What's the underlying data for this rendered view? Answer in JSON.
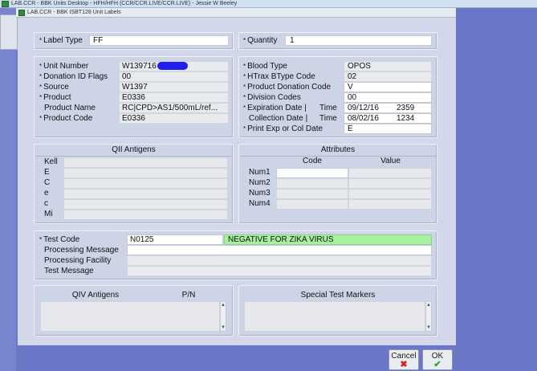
{
  "app": {
    "title": "LAB.CCR - BBK Units Desktop - HFH/HFH (CCR/CCR.LIVE/CCR.LIVE) - Jessie W Beeley"
  },
  "dialog": {
    "title": "LAB.CCR - BBK ISBT128 Unit Labels"
  },
  "top": {
    "label_type_label": "Label Type",
    "label_type_value": "FF",
    "quantity_label": "Quantity",
    "quantity_value": "1"
  },
  "unit": {
    "unit_number_label": "Unit Number",
    "unit_number_value": "W139716",
    "donation_flags_label": "Donation ID Flags",
    "donation_flags_value": "00",
    "source_label": "Source",
    "source_value": "W1397",
    "product_label": "Product",
    "product_value": "E0336",
    "product_name_label": "Product Name",
    "product_name_value": "RC|CPD>AS1/500mL/ref...",
    "product_code_label": "Product Code",
    "product_code_value": "E0336"
  },
  "blood": {
    "blood_type_label": "Blood Type",
    "blood_type_value": "OPOS",
    "htrax_label": "HTrax BType Code",
    "htrax_value": "02",
    "pdc_label": "Product Donation Code",
    "pdc_value": "V",
    "division_label": "Division Codes",
    "division_value": "00",
    "exp_label": "Expiration Date |",
    "exp_time_label": "Time",
    "exp_date": "09/12/16",
    "exp_time": "2359",
    "col_label": "Collection Date |",
    "col_time_label": "Time",
    "col_date": "08/02/16",
    "col_time": "1234",
    "print_label": "Print Exp or Col Date",
    "print_value": "E"
  },
  "qii": {
    "title": "QII Antigens",
    "rows": [
      "Kell",
      "E",
      "C",
      "e",
      "c",
      "Mi"
    ]
  },
  "attributes": {
    "title": "Attributes",
    "code_header": "Code",
    "value_header": "Value",
    "rows": [
      "Num1",
      "Num2",
      "Num3",
      "Num4"
    ]
  },
  "test": {
    "test_code_label": "Test Code",
    "test_code_value": "N0125",
    "test_result": "NEGATIVE FOR ZIKA VIRUS",
    "processing_message_label": "Processing Message",
    "processing_facility_label": "Processing Facility",
    "test_message_label": "Test Message"
  },
  "qiv": {
    "title": "QIV Antigens",
    "pn_header": "P/N"
  },
  "stm": {
    "title": "Special Test Markers"
  },
  "buttons": {
    "cancel_label": "Cancel",
    "cancel_glyph": "✖",
    "ok_label": "OK",
    "ok_glyph": "✔"
  },
  "colors": {
    "test_result_bg": "#a6f0a0",
    "redaction": "#1f1ff0",
    "frame": "#6b78c8"
  },
  "icons": [
    "app-icon",
    "dialog-icon",
    "scroll-up-icon",
    "scroll-down-icon",
    "cancel-x-icon",
    "ok-check-icon"
  ]
}
